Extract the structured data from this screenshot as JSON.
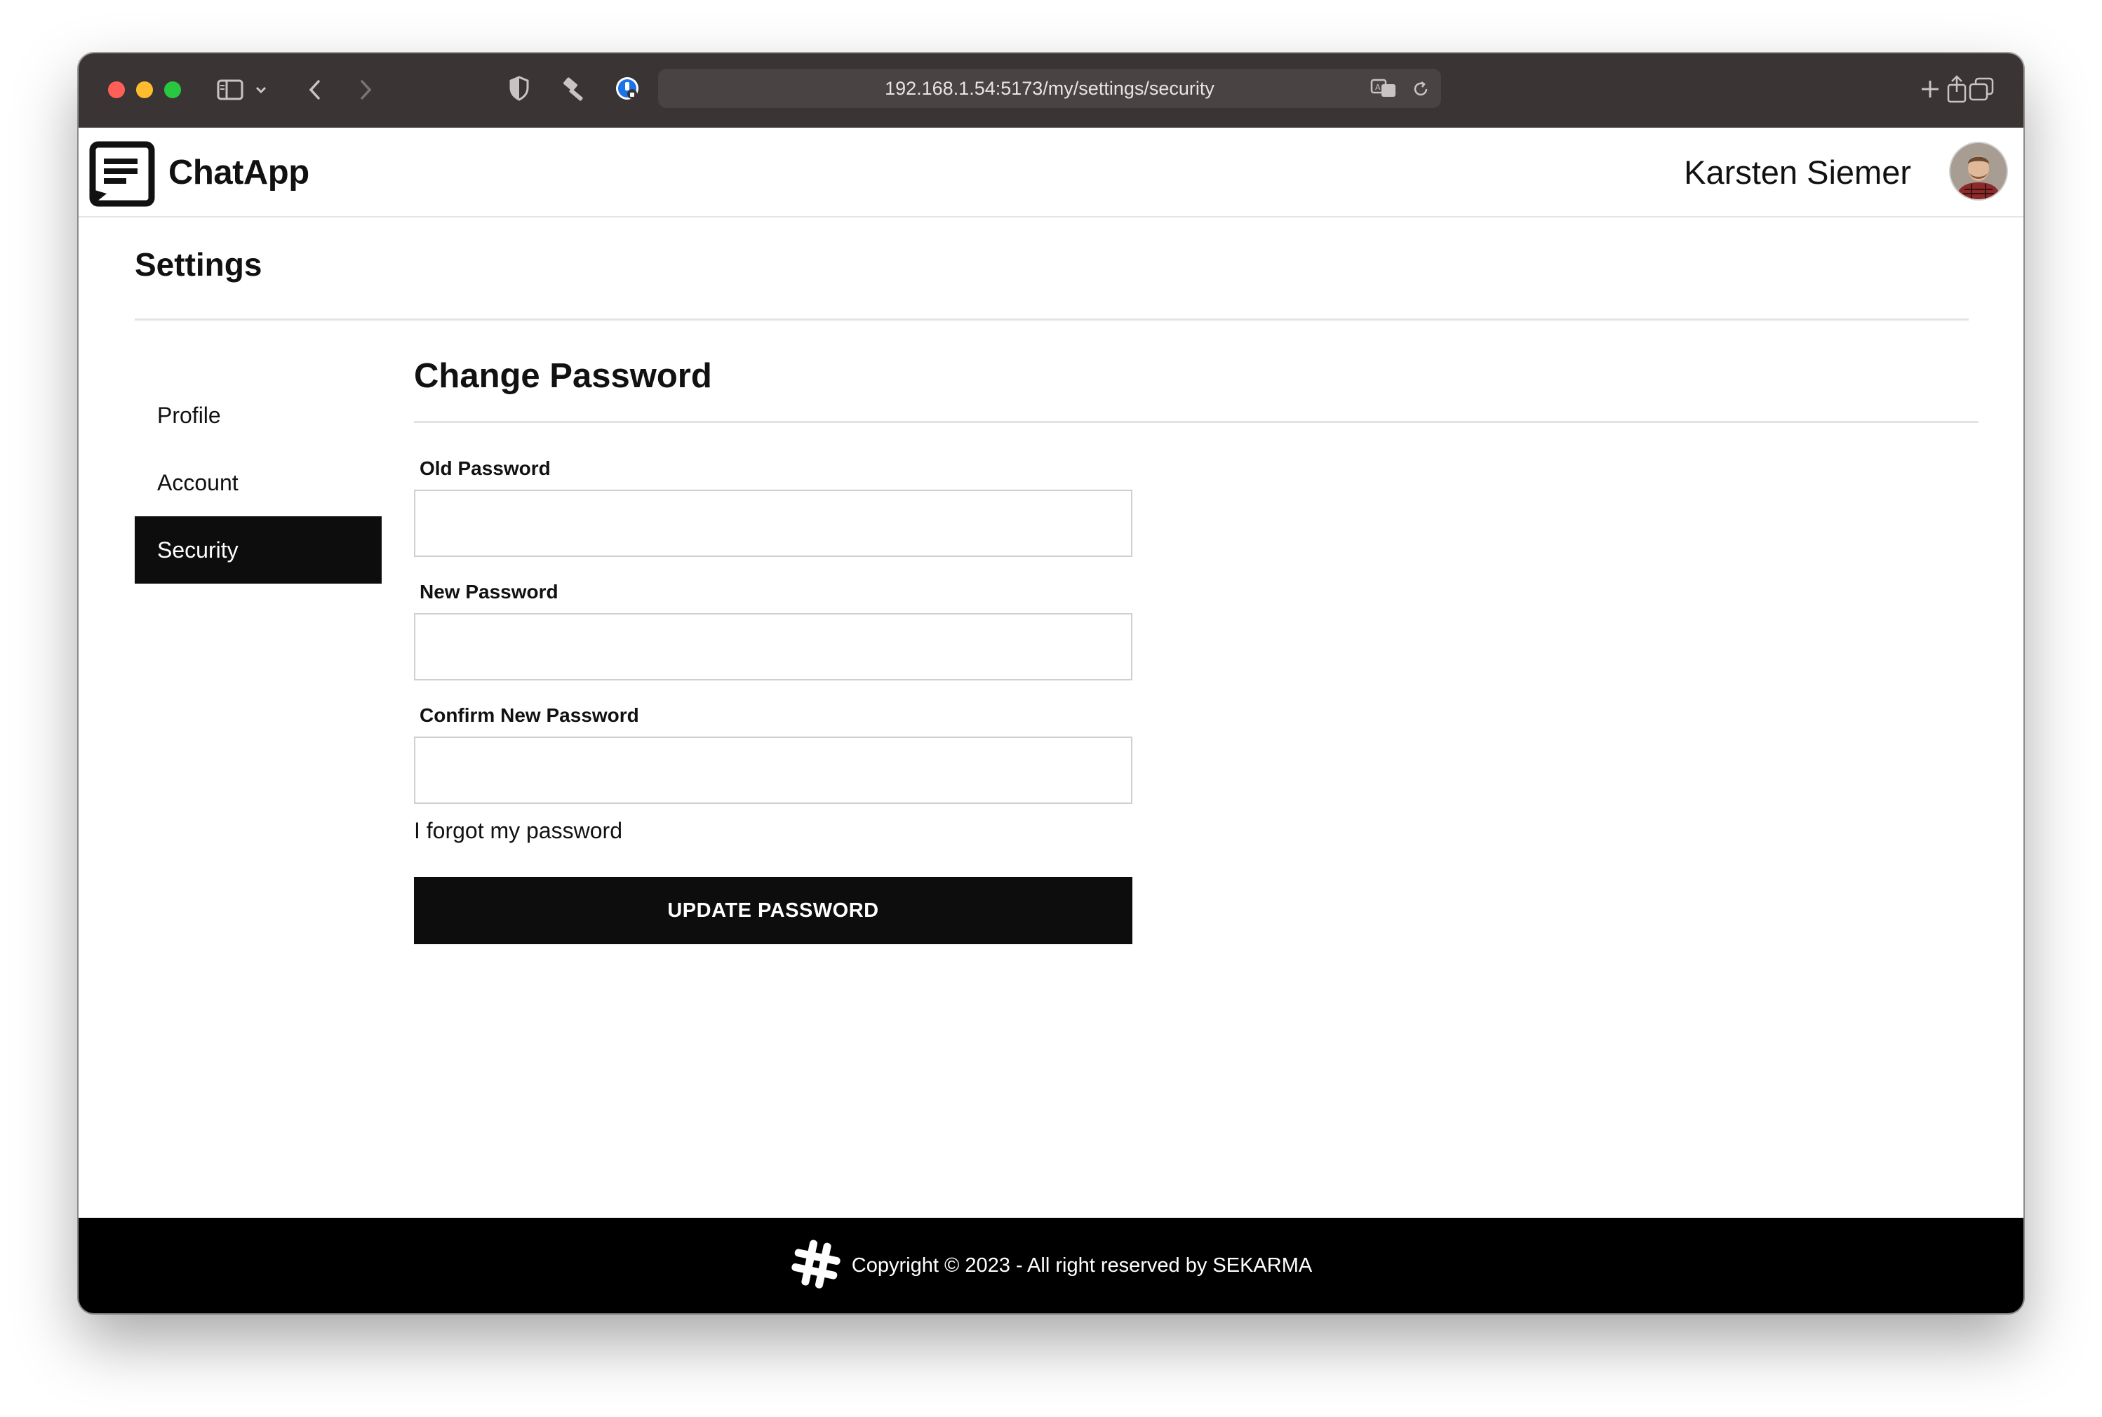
{
  "browser": {
    "url": "192.168.1.54:5173/my/settings/security"
  },
  "header": {
    "brand": "ChatApp",
    "user_name": "Karsten Siemer"
  },
  "settings": {
    "title": "Settings",
    "nav": [
      {
        "label": "Profile",
        "active": false
      },
      {
        "label": "Account",
        "active": false
      },
      {
        "label": "Security",
        "active": true
      }
    ]
  },
  "security": {
    "section_title": "Change Password",
    "fields": [
      {
        "label": "Old Password",
        "value": "",
        "type": "password"
      },
      {
        "label": "New Password",
        "value": "",
        "type": "password"
      },
      {
        "label": "Confirm New Password",
        "value": "",
        "type": "password"
      }
    ],
    "forgot_link": "I forgot my password",
    "submit_label": "UPDATE PASSWORD"
  },
  "footer": {
    "copyright": "Copyright © 2023 - All right reserved by SEKARMA"
  },
  "colors": {
    "chrome_bg": "#3b3434",
    "accent_dark": "#0d0d0d",
    "footer_bg": "#000000",
    "divider": "#e3e3e3"
  }
}
